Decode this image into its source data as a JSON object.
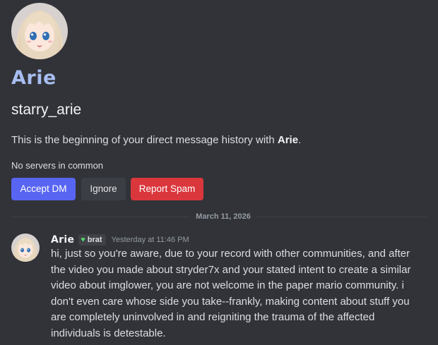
{
  "profile": {
    "display_name": "Arie",
    "username": "starry_arie",
    "intro_prefix": "This is the beginning of your direct message history with ",
    "intro_name": "Arie",
    "intro_suffix": ".",
    "mutual_servers": "No servers in common"
  },
  "actions": {
    "accept_label": "Accept DM",
    "ignore_label": "Ignore",
    "report_label": "Report Spam"
  },
  "divider": {
    "date": "March 11, 2026"
  },
  "message": {
    "author": "Arie",
    "tag_icon": "green-heart-icon",
    "tag_label": "brat",
    "timestamp": "Yesterday at 11:46 PM",
    "text": "hi, just so you're aware, due to your record with other communities, and after the video you made about stryder7x and your stated intent to create a similar video about imglower, you are not welcome in the paper mario community. i don't even care whose side you take--frankly, making content about stuff you are completely uninvolved in and reigniting the trauma of the affected individuals is detestable."
  },
  "colors": {
    "background": "#313338",
    "accent": "#5865f2",
    "danger": "#da373c",
    "display_name": "#a8bdf0",
    "tag_heart": "#57d36a"
  }
}
